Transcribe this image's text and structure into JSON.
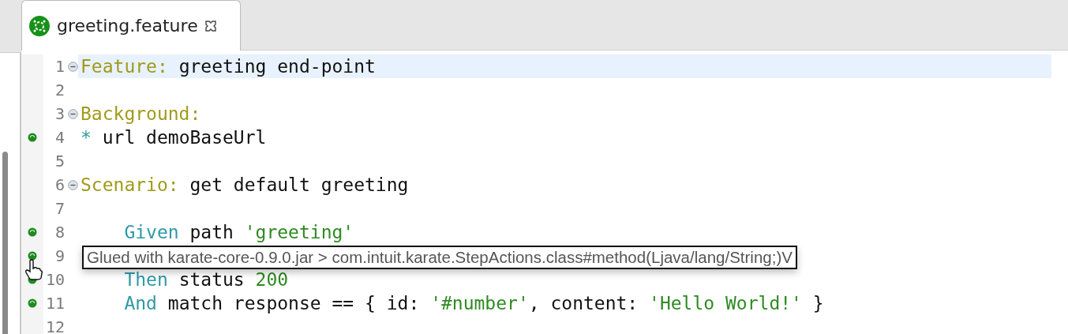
{
  "tab": {
    "label": "greeting.feature",
    "selected": true
  },
  "lines": [
    {
      "number": "1",
      "fold": true,
      "marker": false,
      "current": true,
      "tokens": [
        {
          "kind": "keyword",
          "text": "Feature:"
        },
        {
          "kind": "plain",
          "text": " greeting end-point"
        }
      ]
    },
    {
      "number": "2",
      "fold": false,
      "marker": false,
      "current": false
    },
    {
      "number": "3",
      "fold": true,
      "marker": false,
      "current": false,
      "tokens": [
        {
          "kind": "keyword",
          "text": "Background:"
        }
      ]
    },
    {
      "number": "4",
      "fold": false,
      "marker": true,
      "current": false,
      "tokens": [
        {
          "kind": "step",
          "text": "*"
        },
        {
          "kind": "plain",
          "text": " url demoBaseUrl"
        }
      ]
    },
    {
      "number": "5",
      "fold": false,
      "marker": false,
      "current": false
    },
    {
      "number": "6",
      "fold": true,
      "marker": false,
      "current": false,
      "tokens": [
        {
          "kind": "keyword",
          "text": "Scenario:"
        },
        {
          "kind": "plain",
          "text": " get default greeting"
        }
      ]
    },
    {
      "number": "7",
      "fold": false,
      "marker": false,
      "current": false
    },
    {
      "number": "8",
      "fold": false,
      "marker": true,
      "current": false,
      "tokens": [
        {
          "kind": "step",
          "text": "    Given"
        },
        {
          "kind": "plain",
          "text": " path "
        },
        {
          "kind": "string",
          "text": "'greeting'"
        }
      ]
    },
    {
      "number": "9",
      "fold": false,
      "marker": true,
      "current": false
    },
    {
      "number": "10",
      "fold": false,
      "marker": true,
      "current": false,
      "tokens": [
        {
          "kind": "step",
          "text": "    Then"
        },
        {
          "kind": "plain",
          "text": " status "
        },
        {
          "kind": "string",
          "text": "200"
        }
      ]
    },
    {
      "number": "11",
      "fold": false,
      "marker": true,
      "current": false,
      "tokens": [
        {
          "kind": "step",
          "text": "    And"
        },
        {
          "kind": "plain",
          "text": " match response == { id: "
        },
        {
          "kind": "string",
          "text": "'#number'"
        },
        {
          "kind": "plain",
          "text": ", content: "
        },
        {
          "kind": "string",
          "text": "'Hello World!'"
        },
        {
          "kind": "plain",
          "text": " }"
        }
      ]
    },
    {
      "number": "12",
      "fold": false,
      "marker": false,
      "current": false
    }
  ],
  "tooltip": {
    "text": "Glued with karate-core-0.9.0.jar > com.intuit.karate.StepActions.class#method(Ljava/lang/String;)V"
  }
}
